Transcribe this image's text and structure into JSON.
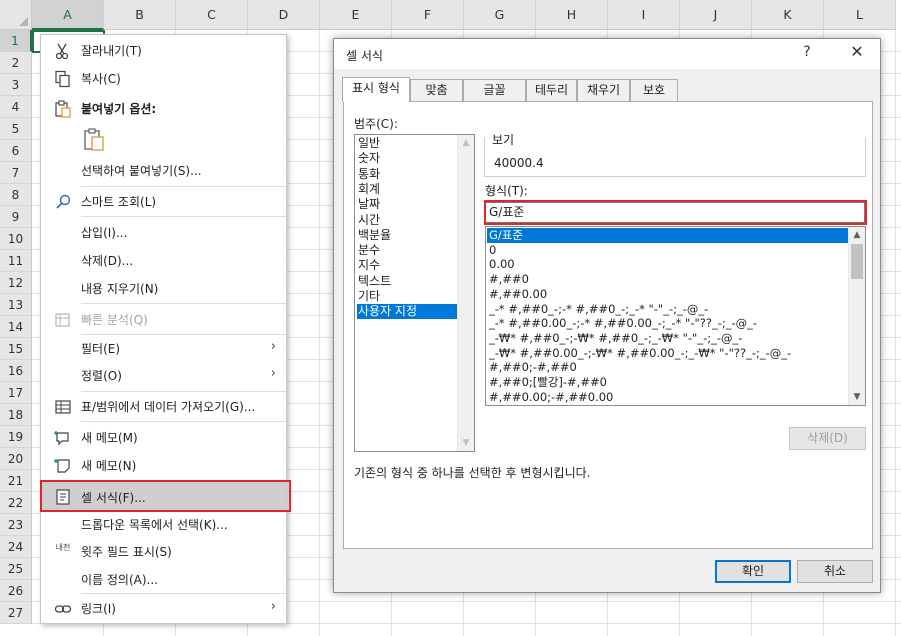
{
  "sheet": {
    "columns": [
      "A",
      "B",
      "C",
      "D",
      "E",
      "F",
      "G",
      "H",
      "I",
      "J",
      "K",
      "L"
    ],
    "rows": [
      "1",
      "2",
      "3",
      "4",
      "5",
      "6",
      "7",
      "8",
      "9",
      "10",
      "11",
      "12",
      "13",
      "14",
      "15",
      "16",
      "17",
      "18",
      "19",
      "20",
      "21",
      "22",
      "23",
      "24",
      "25",
      "26",
      "27"
    ],
    "active_column": "A",
    "active_row": "1"
  },
  "context_menu": {
    "items": [
      {
        "label": "잘라내기(T)",
        "icon": "scissors-icon"
      },
      {
        "label": "복사(C)",
        "icon": "copy-icon"
      },
      {
        "label": "붙여넣기 옵션:",
        "icon": "paste-icon"
      },
      {
        "label": "",
        "icon": "paste-clipboard-icon"
      },
      {
        "label": "선택하여 붙여넣기(S)...",
        "icon": ""
      },
      {
        "label": "스마트 조회(L)",
        "icon": "smart-lookup-icon"
      },
      {
        "label": "삽입(I)...",
        "icon": ""
      },
      {
        "label": "삭제(D)...",
        "icon": ""
      },
      {
        "label": "내용 지우기(N)",
        "icon": ""
      },
      {
        "label": "빠른 분석(Q)",
        "icon": "quick-analysis-icon"
      },
      {
        "label": "필터(E)",
        "icon": ""
      },
      {
        "label": "정렬(O)",
        "icon": ""
      },
      {
        "label": "표/범위에서 데이터 가져오기(G)...",
        "icon": "table-icon"
      },
      {
        "label": "새 메모(M)",
        "icon": "new-comment-icon"
      },
      {
        "label": "새 메모(N)",
        "icon": "new-note-icon"
      },
      {
        "label": "셀 서식(F)...",
        "icon": "format-cells-icon"
      },
      {
        "label": "드롭다운 목록에서 선택(K)...",
        "icon": ""
      },
      {
        "label": "윗주 필드 표시(S)",
        "icon": "phonetic-icon"
      },
      {
        "label": "이름 정의(A)...",
        "icon": ""
      },
      {
        "label": "링크(I)",
        "icon": "link-icon"
      }
    ],
    "phonetic_icon_text": "내천",
    "submenu_arrow": "›"
  },
  "dialog": {
    "title": "셀 서식",
    "help": "?",
    "close": "✕",
    "tabs": [
      "표시 형식",
      "맞춤",
      "글꼴",
      "테두리",
      "채우기",
      "보호"
    ],
    "active_tab": "표시 형식",
    "category_label": "범주(C):",
    "categories": [
      "일반",
      "숫자",
      "통화",
      "회계",
      "날짜",
      "시간",
      "백분율",
      "분수",
      "지수",
      "텍스트",
      "기타",
      "사용자 지정"
    ],
    "selected_category": "사용자 지정",
    "sample_label": "보기",
    "sample_value": "40000.4",
    "type_label": "형식(T):",
    "type_value": "G/표준",
    "formats": [
      "G/표준",
      "0",
      "0.00",
      "#,##0",
      "#,##0.00",
      "_-* #,##0_-;-* #,##0_-;_-* \"-\"_-;_-@_-",
      "_-* #,##0.00_-;-* #,##0.00_-;_-* \"-\"??_-;_-@_-",
      "_-₩* #,##0_-;-₩* #,##0_-;_-₩* \"-\"_-;_-@_-",
      "_-₩* #,##0.00_-;-₩* #,##0.00_-;_-₩* \"-\"??_-;_-@_-",
      "#,##0;-#,##0",
      "#,##0;[빨강]-#,##0",
      "#,##0.00;-#,##0.00"
    ],
    "selected_format": "G/표준",
    "delete_button": "삭제(D)",
    "description": "기존의 형식 중 하나를 선택한 후 변형시킵니다.",
    "ok_button": "확인",
    "cancel_button": "취소"
  }
}
